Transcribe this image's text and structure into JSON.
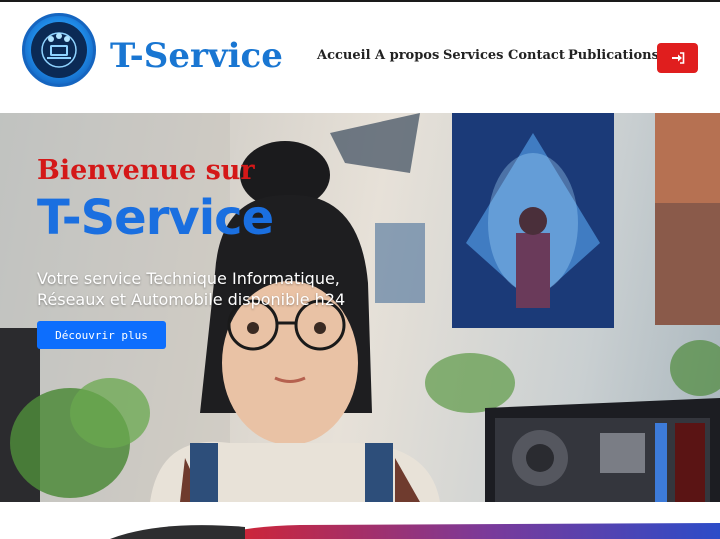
{
  "brand": {
    "name": "T-Service",
    "logo_icon": "tech-support-logo-icon"
  },
  "nav": {
    "items": [
      {
        "label": "Accueil"
      },
      {
        "label": "A propos"
      },
      {
        "label": "Services"
      },
      {
        "label": "Contact"
      },
      {
        "label": "Publications"
      }
    ],
    "login_icon": "sign-in-icon"
  },
  "hero": {
    "welcome": "Bienvenue sur",
    "title": "T-Service",
    "tagline": "Votre service Technique Informatique, Réseaux et Automobile disponible h24",
    "cta_label": "Découvrir plus"
  },
  "colors": {
    "brand_blue": "#1976d2",
    "accent_red": "#e01e1e",
    "cta_blue": "#0d6efd"
  }
}
